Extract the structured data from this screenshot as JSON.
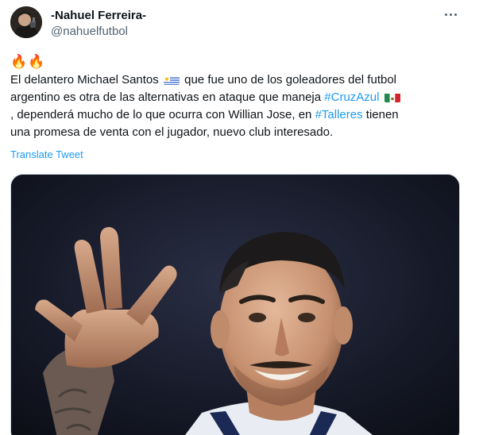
{
  "author": {
    "display_name": "-Nahuel Ferreira-",
    "handle": "@nahuelfutbol"
  },
  "tweet": {
    "fire": "🔥🔥",
    "segments": {
      "s1": "El delantero Michael Santos",
      "s2": "que fue uno de los goleadores del futbol",
      "s3": "argentino es otra de las alternativas en ataque que maneja",
      "hashtag1": "#CruzAzul",
      "s4": ", dependerá mucho de lo que ocurra con Willian Jose, en",
      "hashtag2": "#Talleres",
      "s5": "tienen",
      "s6": "una promesa de venta con el jugador, nuevo club interesado."
    },
    "flag_uruguay": "uruguay-flag-icon",
    "flag_mexico": "mexico-flag-icon"
  },
  "translate_label": "Translate Tweet",
  "colors": {
    "link": "#1d9bf0",
    "secondary_text": "#536471",
    "primary_text": "#0f1419"
  }
}
